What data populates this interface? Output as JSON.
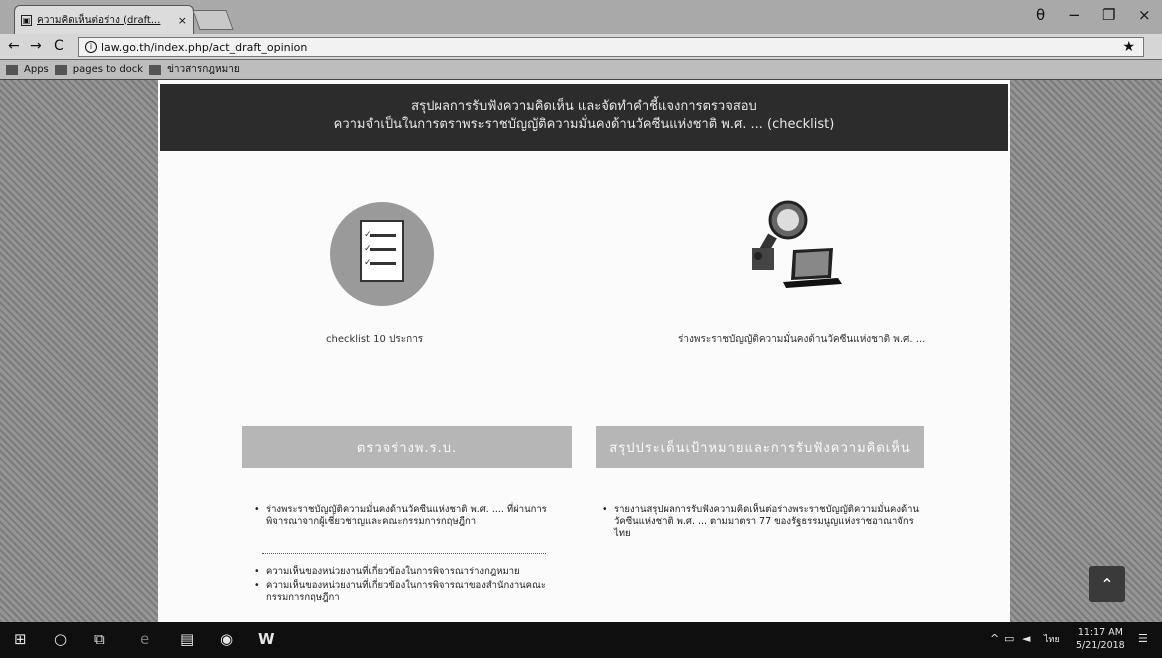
{
  "browser": {
    "tab_title": "ความคิดเห็นต่อร่าง (draft...",
    "tab_close": "×",
    "url": "law.go.th/index.php/act_draft_opinion",
    "controls": {
      "account": "θ",
      "minimize": "−",
      "restore": "❐",
      "close": "×"
    },
    "nav": {
      "back": "←",
      "forward": "→",
      "reload": "C"
    },
    "bookmarks": [
      "Apps",
      "pages to dock",
      "ข่าวสารกฎหมาย"
    ]
  },
  "banner": {
    "line1": "สรุปผลการรับฟังความคิดเห็น และจัดทำคำชี้แจงการตรวจสอบ",
    "line2": "ความจำเป็นในการตราพระราชบัญญัติความมั่นคงด้านวัคซีนแห่งชาติ พ.ศ. ... (checklist)"
  },
  "cards": {
    "left_label": "checklist 10 ประการ",
    "right_label": "ร่างพระราชบัญญัติความมั่นคงด้านวัคซีนแห่งชาติ พ.ศ. ..."
  },
  "buttons": {
    "left": "ตรวจร่างพ.ร.บ.",
    "right": "สรุปประเด็นเป้าหมายและการรับฟังความคิดเห็น"
  },
  "left_bullets_top": [
    "ร่างพระราชบัญญัติความมั่นคงด้านวัคซีนแห่งชาติ พ.ศ. .... ที่ผ่านการพิจารณาจากผู้เชี่ยวชาญและคณะกรรมการกฤษฎีกา"
  ],
  "left_bullets_bottom": [
    "ความเห็นของหน่วยงานที่เกี่ยวข้องในการพิจารณาร่างกฎหมาย",
    "ความเห็นของหน่วยงานที่เกี่ยวข้องในการพิจารณาของสำนักงานคณะกรรมการกฤษฎีกา"
  ],
  "right_bullets": [
    "รายงานสรุปผลการรับฟังความคิดเห็นต่อร่างพระราชบัญญัติความมั่นคงด้านวัคซีนแห่งชาติ พ.ศ. ... ตามมาตรา 77 ของรัฐธรรมนูญแห่งราชอาณาจักรไทย"
  ],
  "scroll_top_glyph": "⌃",
  "taskbar": {
    "start": "⊞",
    "search": "○",
    "taskview": "⧉",
    "lang": "ไทย",
    "time": "11:17 AM",
    "date": "5/21/2018",
    "notifications": "☰"
  }
}
